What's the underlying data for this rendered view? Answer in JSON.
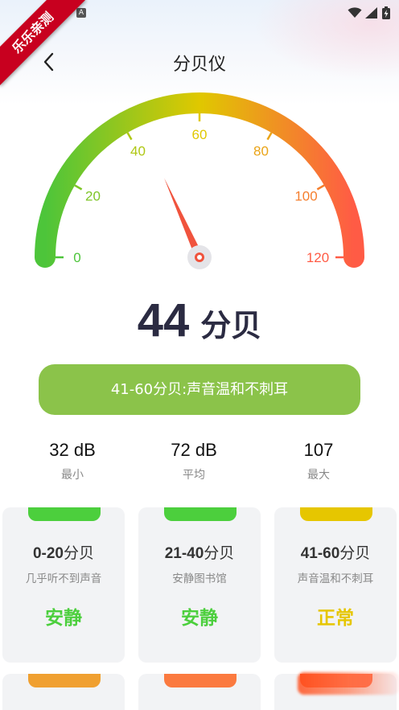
{
  "status_bar": {
    "badge": "A"
  },
  "ribbon": "乐乐亲测",
  "header": {
    "title": "分贝仪",
    "back_icon": "chevron-left-icon"
  },
  "gauge": {
    "min": 0,
    "max": 120,
    "value": 44,
    "ticks": [
      "0",
      "20",
      "40",
      "60",
      "80",
      "100",
      "120"
    ],
    "colors": {
      "low": "#4dc53a",
      "mid": "#e0c800",
      "high": "#ff5b45"
    }
  },
  "reading": {
    "value": "44",
    "unit": "分贝"
  },
  "level_banner": {
    "text": "41-60分贝:声音温和不刺耳",
    "color": "#8bc34a"
  },
  "stats": [
    {
      "value": "32 dB",
      "label": "最小"
    },
    {
      "value": "72 dB",
      "label": "平均"
    },
    {
      "value": "107",
      "label": "最大"
    }
  ],
  "cards": [
    {
      "range": "0-20",
      "unit": "分贝",
      "desc": "几乎听不到声音",
      "level": "安静",
      "color": "#4ccf3d"
    },
    {
      "range": "21-40",
      "unit": "分贝",
      "desc": "安静图书馆",
      "level": "安静",
      "color": "#4ccf3d"
    },
    {
      "range": "41-60",
      "unit": "分贝",
      "desc": "声音温和不刺耳",
      "level": "正常",
      "color": "#e6c600"
    }
  ],
  "cards_row2": [
    {
      "color": "#f0a030"
    },
    {
      "color": "#fb7a3f"
    },
    {
      "color": "#ff5528"
    }
  ]
}
